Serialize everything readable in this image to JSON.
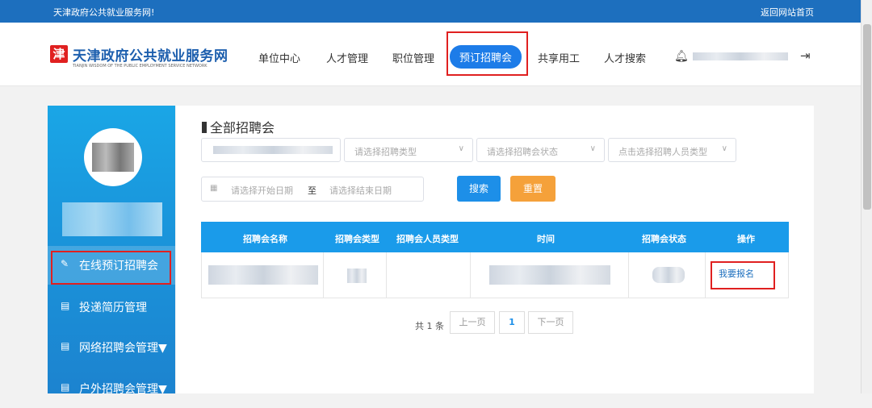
{
  "topbar": {
    "welcome": "天津政府公共就业服务网!",
    "home_link": "返回网站首页"
  },
  "logo": {
    "char": "津",
    "title": "天津政府公共就业服务网",
    "subtitle": "TIANJIN WISDOM OF THE PUBLIC EMPLOYMENT SERVICE NETWORK"
  },
  "nav": [
    "单位中心",
    "人才管理",
    "职位管理",
    "预订招聘会",
    "共享用工",
    "人才搜索"
  ],
  "header_icons": {
    "bell": "bell-icon",
    "logout": "logout-icon"
  },
  "sidebar": {
    "items": [
      {
        "label": "在线预订招聘会",
        "icon": "edit-icon"
      },
      {
        "label": "投递简历管理",
        "icon": "briefcase-icon"
      },
      {
        "label": "网络招聘会管理▼",
        "icon": "briefcase-icon"
      },
      {
        "label": "户外招聘会管理▼",
        "icon": "briefcase-icon"
      }
    ]
  },
  "main": {
    "title": "全部招聘会",
    "filters": {
      "type_placeholder": "请选择招聘类型",
      "status_placeholder": "请选择招聘会状态",
      "person_type_placeholder": "点击选择招聘人员类型",
      "start_date_placeholder": "请选择开始日期",
      "to_label": "至",
      "end_date_placeholder": "请选择结束日期"
    },
    "search_button": "搜索",
    "reset_button": "重置",
    "table": {
      "headers": [
        "招聘会名称",
        "招聘会类型",
        "招聘会人员类型",
        "时间",
        "招聘会状态",
        "操作"
      ],
      "action_label": "我要报名"
    },
    "pagination": {
      "total": "共 1 条",
      "prev": "上一页",
      "page": "1",
      "next": "下一页"
    }
  },
  "colors": {
    "brand": "#1d6fbe",
    "accent": "#1d7ce8",
    "reset": "#f5a13a",
    "highlight": "#e02020"
  }
}
